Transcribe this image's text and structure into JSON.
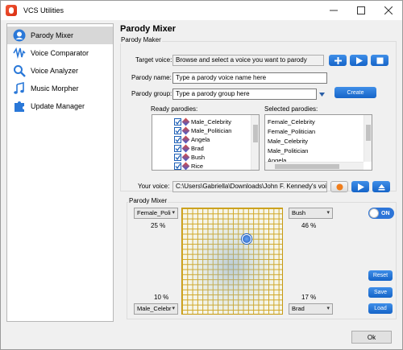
{
  "window": {
    "title": "VCS Utilities"
  },
  "sidebar": {
    "items": [
      {
        "label": "Parody Mixer",
        "icon": "user-head-icon"
      },
      {
        "label": "Voice Comparator",
        "icon": "waveform-icon"
      },
      {
        "label": "Voice Analyzer",
        "icon": "magnifier-icon"
      },
      {
        "label": "Music Morpher",
        "icon": "music-notes-icon"
      },
      {
        "label": "Update Manager",
        "icon": "puzzle-icon"
      }
    ]
  },
  "main": {
    "title": "Parody Mixer"
  },
  "parody_maker": {
    "group_label": "Parody Maker",
    "target_voice_label": "Target voice:",
    "target_voice_value": "Browse and select a voice you want to parody",
    "parody_name_label": "Parody name:",
    "parody_name_value": "Type a parody voice name here",
    "parody_group_label": "Parody group:",
    "parody_group_value": "Type a parody group here",
    "create_label": "Create",
    "ready_label": "Ready parodies:",
    "selected_label": "Selected parodies:",
    "ready_items": [
      "Male_Celebrity",
      "Male_Politician",
      "Angela",
      "Brad",
      "Bush",
      "Rice"
    ],
    "selected_items": [
      "Female_Celebrity",
      "Female_Politician",
      "Male_Celebrity",
      "Male_Politician",
      "Angela"
    ],
    "your_voice_label": "Your voice:",
    "your_voice_value": "C:\\Users\\Gabriella\\Downloads\\John F. Kennedy's voice p"
  },
  "parody_mixer": {
    "group_label": "Parody Mixer",
    "top_left": {
      "value": "Female_Poli",
      "percent": "25 %"
    },
    "top_right": {
      "value": "Bush",
      "percent": "46 %"
    },
    "bottom_left": {
      "value": "Male_Celebr",
      "percent": "10 %"
    },
    "bottom_right": {
      "value": "Brad",
      "percent": "17 %"
    },
    "toggle_label": "ON",
    "reset_label": "Reset",
    "save_label": "Save",
    "load_label": "Load"
  },
  "footer": {
    "ok_label": "Ok"
  },
  "colors": {
    "accent": "#1f6fd6",
    "grid": "#d0a623"
  }
}
